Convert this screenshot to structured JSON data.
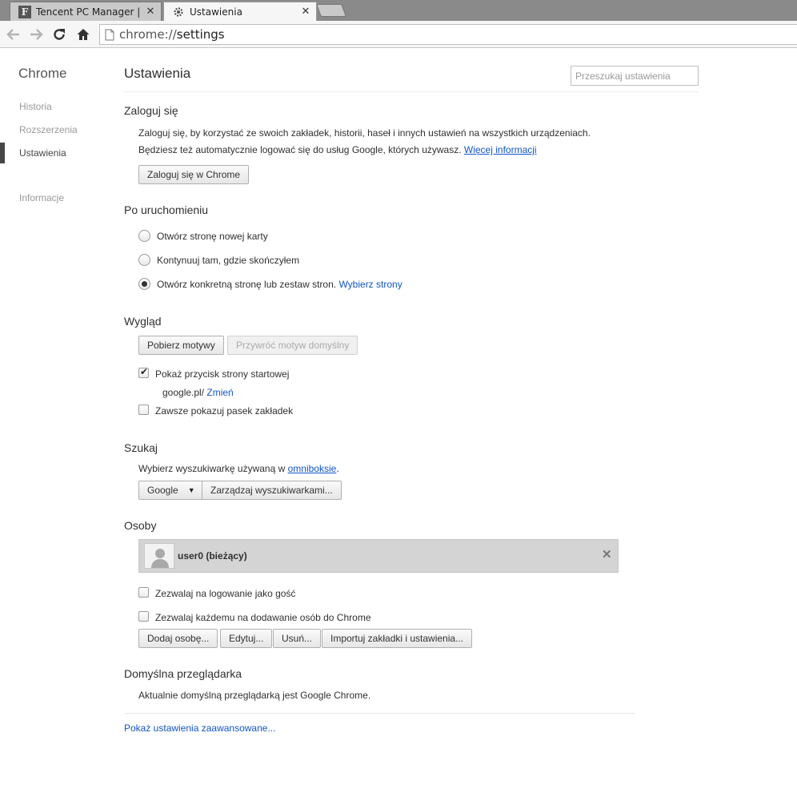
{
  "tabs": [
    {
      "title": "Tencent PC Manager | pro",
      "favicon": "F",
      "close": "✕"
    },
    {
      "title": "Ustawienia",
      "close": "✕"
    }
  ],
  "address_bar": {
    "scheme": "chrome://",
    "host": "settings"
  },
  "sidebar": {
    "title": "Chrome",
    "items": [
      {
        "label": "Historia"
      },
      {
        "label": "Rozszerzenia"
      },
      {
        "label": "Ustawienia"
      },
      {
        "label": "Informacje"
      }
    ]
  },
  "header": {
    "title": "Ustawienia",
    "search_placeholder": "Przeszukaj ustawienia"
  },
  "signin": {
    "heading": "Zaloguj się",
    "line1": "Zaloguj się, by korzystać ze swoich zakładek, historii, haseł i innych ustawień na wszystkich urządzeniach.",
    "line2": "Będziesz też automatycznie logować się do usług Google, których używasz.",
    "more_link": "Więcej informacji",
    "button": "Zaloguj się w Chrome"
  },
  "startup": {
    "heading": "Po uruchomieniu",
    "option1": "Otwórz stronę nowej karty",
    "option2": "Kontynuuj tam, gdzie skończyłem",
    "option3": "Otwórz konkretną stronę lub zestaw stron.",
    "option3_link": "Wybierz strony",
    "selected": 3
  },
  "appearance": {
    "heading": "Wygląd",
    "get_themes": "Pobierz motywy",
    "reset_theme": "Przywróć motyw domyślny",
    "show_home": "Pokaż przycisk strony startowej",
    "home_url": "google.pl/",
    "change_link": "Zmień",
    "show_bookmarks": "Zawsze pokazuj pasek zakładek"
  },
  "search": {
    "heading": "Szukaj",
    "text_before": "Wybierz wyszukiwarkę używaną w",
    "omnibox_link": "omniboksie",
    "text_after": ".",
    "engine": "Google",
    "manage": "Zarządzaj wyszukiwarkami..."
  },
  "people": {
    "heading": "Osoby",
    "profile_name": "user0 (bieżący)",
    "remove_symbol": "✕",
    "guest": "Zezwalaj na logowanie jako gość",
    "add_anyone": "Zezwalaj każdemu na dodawanie osób do Chrome",
    "add_btn": "Dodaj osobę...",
    "edit_btn": "Edytuj...",
    "remove_btn": "Usuń...",
    "import_btn": "Importuj zakładki i ustawienia..."
  },
  "default_browser": {
    "heading": "Domyślna przeglądarka",
    "text": "Aktualnie domyślną przeglądarką jest Google Chrome."
  },
  "advanced_link": "Pokaż ustawienia zaawansowane..."
}
